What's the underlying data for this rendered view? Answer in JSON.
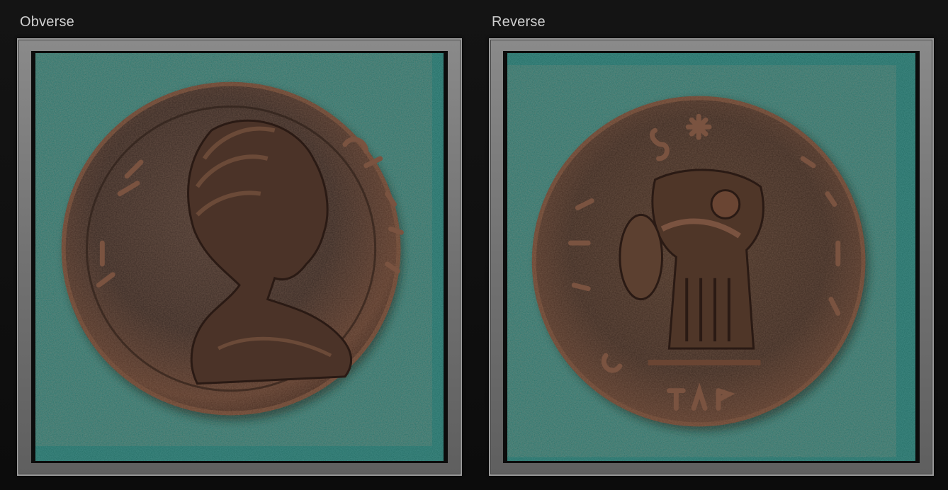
{
  "panels": {
    "obverse": {
      "title": "Obverse"
    },
    "reverse": {
      "title": "Reverse"
    }
  },
  "colors": {
    "background": "#0f0f0f",
    "frame": "#757575",
    "felt": "#1f6b63",
    "bronze": "#5a3a2c",
    "label": "#cfcfcf"
  }
}
